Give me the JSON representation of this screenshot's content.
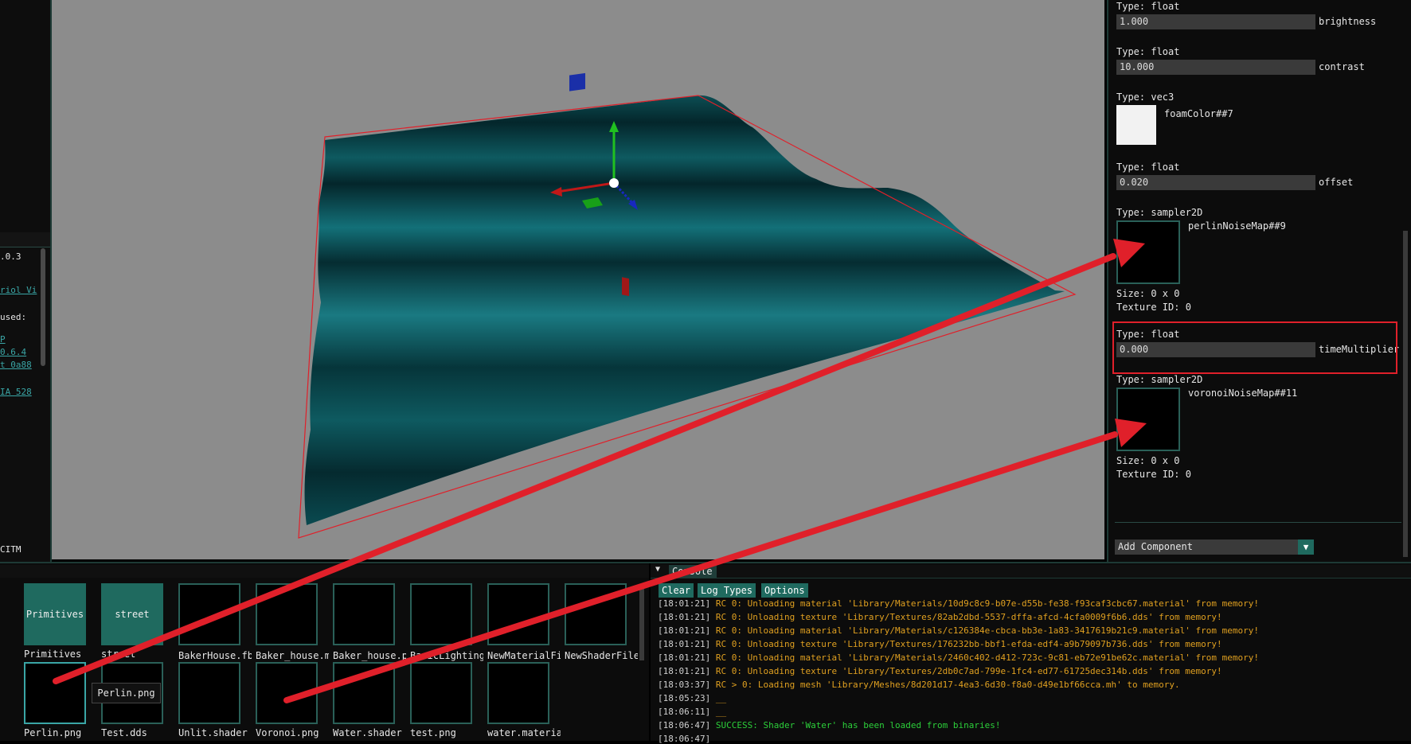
{
  "left_panel": {
    "lines": [
      {
        "text": ".0.3",
        "link": false
      },
      {
        "text": "riol Vi",
        "link": true
      },
      {
        "text": " used:",
        "link": false
      },
      {
        "text": "P",
        "link": true
      },
      {
        "text": "0.6.4",
        "link": true
      },
      {
        "text": "t 0a88",
        "link": true
      },
      {
        "text": "IA 528",
        "link": true
      }
    ],
    "footer": "CITM"
  },
  "inspector": {
    "properties": [
      {
        "type_label": "Type: float",
        "value": "1.000",
        "name": "brightness"
      },
      {
        "type_label": "Type: float",
        "value": "10.000",
        "name": "contrast"
      },
      {
        "type_label": "Type: vec3",
        "name": "foamColor##7",
        "color": "#f2f2f2"
      },
      {
        "type_label": "Type: float",
        "value": "0.020",
        "name": "offset"
      },
      {
        "type_label": "Type: sampler2D",
        "name": "perlinNoiseMap##9",
        "size": "Size: 0 x 0",
        "texture_id": "Texture ID: 0"
      },
      {
        "type_label": "Type: float",
        "value": "0.000",
        "name": "timeMultiplier"
      },
      {
        "type_label": "Type: sampler2D",
        "name": "voronoiNoiseMap##11",
        "size": "Size: 0 x 0",
        "texture_id": "Texture ID: 0"
      }
    ],
    "add_component": "Add Component",
    "dropdown_arrow": "▼"
  },
  "assets": {
    "items": [
      {
        "name": "Primitives",
        "thumb_label": "Primitives",
        "folder": true
      },
      {
        "name": "street",
        "thumb_label": "street",
        "folder": true
      },
      {
        "name": "BakerHouse.fbx",
        "folder": false
      },
      {
        "name": "Baker_house.meta",
        "folder": false
      },
      {
        "name": "Baker_house.png",
        "folder": false
      },
      {
        "name": "BasicLighting",
        "folder": false
      },
      {
        "name": "NewMaterialFile",
        "folder": false
      },
      {
        "name": "NewShaderFile",
        "folder": false
      },
      {
        "name": "Perlin.png",
        "folder": false
      },
      {
        "name": "Test.dds",
        "folder": false
      },
      {
        "name": "Unlit.shader",
        "folder": false
      },
      {
        "name": "Voronoi.png",
        "folder": false
      },
      {
        "name": "Water.shader",
        "folder": false
      },
      {
        "name": "test.png",
        "folder": false
      },
      {
        "name": "water.material",
        "folder": false
      }
    ],
    "tooltip": "Perlin.png"
  },
  "console": {
    "tab_label": "Console",
    "buttons": [
      "Clear",
      "Log Types",
      "Options"
    ],
    "logs": [
      {
        "time": "[18:01:21]",
        "msg": "RC 0: Unloading material 'Library/Materials/10d9c8c9-b07e-d55b-fe38-f93caf3cbc67.material' from memory!",
        "kind": "warn"
      },
      {
        "time": "[18:01:21]",
        "msg": "RC 0: Unloading texture 'Library/Textures/82ab2dbd-5537-dffa-afcd-4cfa0009f6b6.dds' from memory!",
        "kind": "warn"
      },
      {
        "time": "[18:01:21]",
        "msg": "RC 0: Unloading material 'Library/Materials/c126384e-cbca-bb3e-1a83-3417619b21c9.material' from memory!",
        "kind": "warn"
      },
      {
        "time": "[18:01:21]",
        "msg": "RC 0: Unloading texture 'Library/Textures/176232bb-bbf1-efda-edf4-a9b79097b736.dds' from memory!",
        "kind": "warn"
      },
      {
        "time": "[18:01:21]",
        "msg": "RC 0: Unloading material 'Library/Materials/2460c402-d412-723c-9c81-eb72e91be62c.material' from memory!",
        "kind": "warn"
      },
      {
        "time": "[18:01:21]",
        "msg": "RC 0: Unloading texture 'Library/Textures/2db0c7ad-799e-1fc4-ed77-61725dec314b.dds' from memory!",
        "kind": "warn"
      },
      {
        "time": "[18:03:37]",
        "msg": "RC > 0: Loading mesh 'Library/Meshes/8d201d17-4ea3-6d30-f8a0-d49e1bf66cca.mh' to memory.",
        "kind": "warn"
      },
      {
        "time": "[18:05:23]",
        "msg": "__",
        "kind": "warn"
      },
      {
        "time": "[18:06:11]",
        "msg": "__",
        "kind": "warn"
      },
      {
        "time": "[18:06:47]",
        "msg": "SUCCESS: Shader 'Water' has been loaded from binaries!",
        "kind": "ok"
      },
      {
        "time": "[18:06:47]",
        "msg": "",
        "kind": "warn"
      }
    ]
  },
  "colors": {
    "accent": "#1f6a5f",
    "water": "#0e5a60",
    "annotation": "#e0202a",
    "viewport_bg": "#8c8c8c"
  }
}
